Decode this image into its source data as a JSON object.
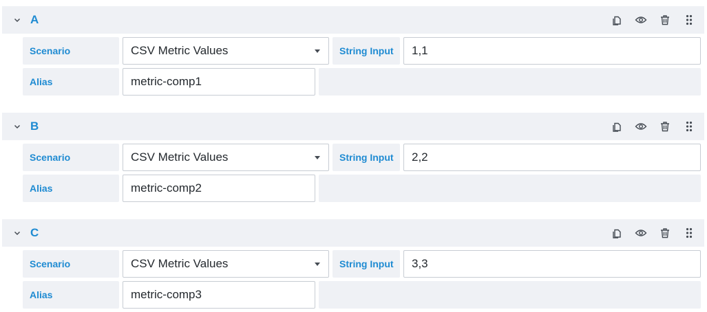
{
  "colors": {
    "accent": "#1f8bd2",
    "panel_bg": "#eff1f5",
    "border": "#c7ccd3"
  },
  "icons": [
    "chevron-down-icon",
    "duplicate-icon",
    "eye-icon",
    "trash-icon",
    "drag-handle-icon"
  ],
  "queries": [
    {
      "ref_id": "A",
      "scenario_label": "Scenario",
      "scenario_value": "CSV Metric Values",
      "string_input_label": "String Input",
      "string_input_value": "1,1",
      "alias_label": "Alias",
      "alias_value": "metric-comp1"
    },
    {
      "ref_id": "B",
      "scenario_label": "Scenario",
      "scenario_value": "CSV Metric Values",
      "string_input_label": "String Input",
      "string_input_value": "2,2",
      "alias_label": "Alias",
      "alias_value": "metric-comp2"
    },
    {
      "ref_id": "C",
      "scenario_label": "Scenario",
      "scenario_value": "CSV Metric Values",
      "string_input_label": "String Input",
      "string_input_value": "3,3",
      "alias_label": "Alias",
      "alias_value": "metric-comp3"
    }
  ]
}
